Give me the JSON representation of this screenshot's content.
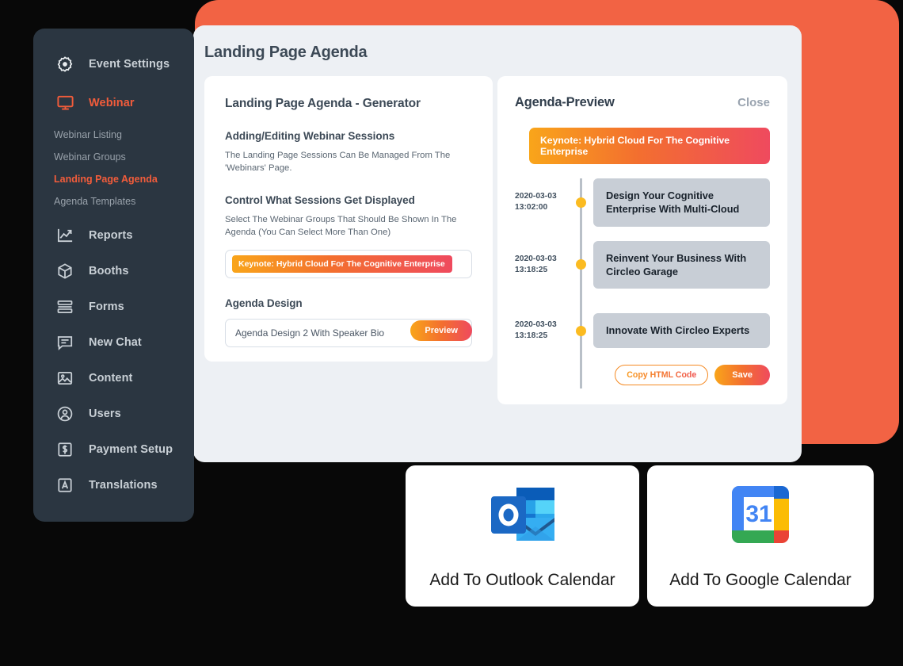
{
  "theme": {
    "background": "#080808",
    "accent_orange": "#F25C3B",
    "backdrop_block": "#F26344",
    "sidebar_bg": "#2B3641",
    "panel_bg": "#EDF0F4",
    "gradient_start": "#F9A51A",
    "gradient_end": "#EF4A5E",
    "timeline_dot": "#FBBB21",
    "timeline_line": "#B9C0C8",
    "session_box": "#C8CED6"
  },
  "sidebar": {
    "items": [
      {
        "label": "Event Settings",
        "icon": "gear-icon",
        "state": "default"
      },
      {
        "label": "Webinar",
        "icon": "monitor-icon",
        "state": "active"
      },
      {
        "label": "Reports",
        "icon": "chart-line-icon",
        "state": "default"
      },
      {
        "label": "Booths",
        "icon": "cube-icon",
        "state": "default"
      },
      {
        "label": "Forms",
        "icon": "forms-icon",
        "state": "default"
      },
      {
        "label": "New Chat",
        "icon": "chat-icon",
        "state": "default"
      },
      {
        "label": "Content",
        "icon": "image-icon",
        "state": "default"
      },
      {
        "label": "Users",
        "icon": "user-circle-icon",
        "state": "default"
      },
      {
        "label": "Payment Setup",
        "icon": "dollar-icon",
        "state": "default"
      },
      {
        "label": "Translations",
        "icon": "letter-a-icon",
        "state": "default"
      }
    ],
    "webinar_subitems": [
      {
        "label": "Webinar  Listing",
        "state": "default"
      },
      {
        "label": "Webinar Groups",
        "state": "default"
      },
      {
        "label": "Landing Page Agenda",
        "state": "active"
      },
      {
        "label": "Agenda Templates",
        "state": "default"
      }
    ]
  },
  "header": {
    "title": "Landing Page Agenda"
  },
  "generator": {
    "card_title": "Landing Page Agenda - Generator",
    "section1_title": "Adding/Editing Webinar Sessions",
    "section1_text": "The Landing Page Sessions Can Be Managed From The 'Webinars' Page.",
    "section2_title": "Control What Sessions Get Displayed",
    "section2_text": "Select The Webinar Groups That Should Be Shown In The Agenda (You Can Select More Than One)",
    "selected_groups": [
      "Keynote: Hybrid Cloud For The Cognitive Enterprise"
    ],
    "design_label": "Agenda Design",
    "design_value": "Agenda Design 2 With Speaker Bio",
    "design_caret": "chevron-down-icon",
    "preview_button": "Preview"
  },
  "preview": {
    "title": "Agenda-Preview",
    "close_label": "Close",
    "keynote_bar": "Keynote: Hybrid Cloud For The Cognitive Enterprise",
    "sessions": [
      {
        "date": "2020-03-03",
        "time": "13:02:00",
        "title": "Design Your Cognitive Enterprise With Multi-Cloud"
      },
      {
        "date": "2020-03-03",
        "time": "13:18:25",
        "title": "Reinvent Your Business With Circleo Garage"
      },
      {
        "date": "2020-03-03",
        "time": "13:18:25",
        "title": "Innovate With Circleo Experts"
      }
    ],
    "copy_button": "Copy HTML Code",
    "save_button": "Save"
  },
  "calendar_cards": [
    {
      "label": "Add To Outlook Calendar",
      "icon": "outlook-icon"
    },
    {
      "label": "Add To Google Calendar",
      "icon": "google-calendar-icon",
      "day_number": "31"
    }
  ]
}
